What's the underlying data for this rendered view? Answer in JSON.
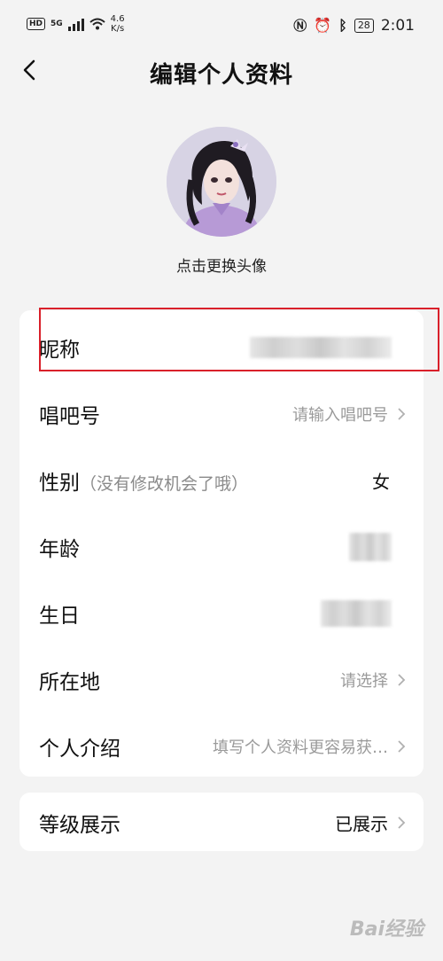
{
  "status_bar": {
    "hd": "HD",
    "network": "5G",
    "speed_value": "4.6",
    "speed_unit": "K/s",
    "battery": "28",
    "time": "2:01"
  },
  "header": {
    "title": "编辑个人资料"
  },
  "avatar": {
    "caption": "点击更换头像"
  },
  "fields": [
    {
      "label": "昵称",
      "value": ""
    },
    {
      "label": "唱吧号",
      "value": "请输入唱吧号"
    },
    {
      "label": "性别",
      "note": "（没有修改机会了哦）",
      "value": "女"
    },
    {
      "label": "年龄",
      "value": ""
    },
    {
      "label": "生日",
      "value": ""
    },
    {
      "label": "所在地",
      "value": "请选择"
    },
    {
      "label": "个人介绍",
      "value": "填写个人资料更容易获…"
    }
  ],
  "level": {
    "label": "等级展示",
    "value": "已展示"
  },
  "watermark": "Bai经验",
  "colors": {
    "highlight": "#d9202a",
    "background": "#f3f3f3",
    "card": "#ffffff"
  }
}
